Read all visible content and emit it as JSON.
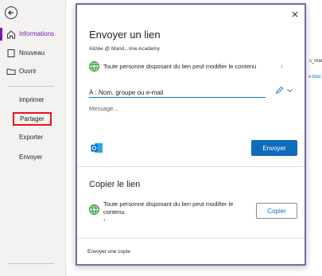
{
  "sidebar": {
    "back_icon": "back-arrow-icon",
    "items": [
      {
        "label": "Informations",
        "icon": "home-icon",
        "active": true
      },
      {
        "label": "Nouveau",
        "icon": "new-page-icon"
      },
      {
        "label": "Ouvrir",
        "icon": "folder-icon"
      },
      {
        "label": "Imprimer"
      },
      {
        "label": "Partager",
        "highlighted": true
      },
      {
        "label": "Exporter"
      },
      {
        "label": "Envoyer"
      }
    ]
  },
  "background": {
    "fragment_1": "s_mar",
    "fragment_2": "e bloc"
  },
  "dialog": {
    "title": "Envoyer un lien",
    "account": "Alizée @ Mand...rine Academy",
    "link_permission": "Toute personne disposant du lien peut modifier le contenu",
    "to_placeholder": "À : Nom, groupe ou e-mail",
    "message_placeholder": "Message...",
    "send_label": "Envoyer",
    "copy_title": "Copier le lien",
    "copy_permission": "Toute personne disposant du lien peut modifier le contenu",
    "copy_label": "Copier",
    "send_copy_label": "Envoyer une copie"
  },
  "colors": {
    "accent": "#7719aa",
    "primary_button": "#0f6cbd",
    "highlight_box": "#e81123",
    "dialog_border": "#7b68a6"
  }
}
